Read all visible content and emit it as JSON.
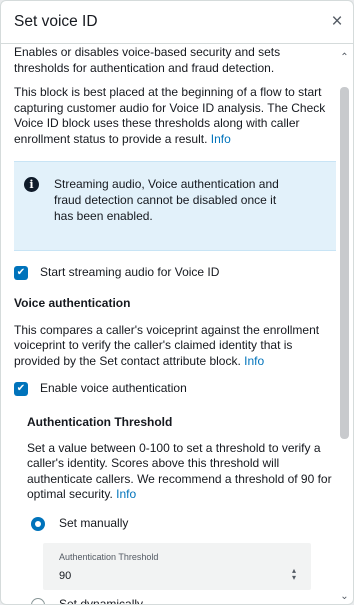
{
  "header": {
    "title": "Set voice ID",
    "close_symbol": "×"
  },
  "intro": {
    "description": "Enables or disables voice-based security and sets thresholds for authentication and fraud detection.",
    "placement_text": "This block is best placed at the beginning of a flow to start capturing customer audio for Voice ID analysis. The Check Voice ID block uses these thresholds along with caller enrollment status to provide a result.",
    "info_link": "Info"
  },
  "alert": {
    "icon": "info-icon",
    "icon_symbol": "i",
    "text": "Streaming audio, Voice authentication and fraud detection cannot be disabled once it has been enabled."
  },
  "streaming_checkbox": {
    "label": "Start streaming audio for Voice ID",
    "checked": true
  },
  "voice_auth": {
    "title": "Voice authentication",
    "description": "This compares a caller's voiceprint against the enrollment voiceprint to verify the caller's claimed identity that is provided by the Set contact attribute block.",
    "info_link": "Info",
    "enable_checkbox": {
      "label": "Enable voice authentication",
      "checked": true
    },
    "threshold": {
      "title": "Authentication Threshold",
      "description": "Set a value between 0-100 to set a threshold to verify a caller's identity. Scores above this threshold will authenticate callers. We recommend a threshold of 90 for optimal security.",
      "info_link": "Info",
      "options": [
        {
          "label": "Set manually",
          "selected": true
        },
        {
          "label": "Set dynamically",
          "selected": false
        }
      ],
      "field_label": "Authentication Threshold",
      "field_value": "90"
    }
  },
  "colors": {
    "accent": "#0073bb",
    "alert_bg": "#e2f1fa"
  }
}
